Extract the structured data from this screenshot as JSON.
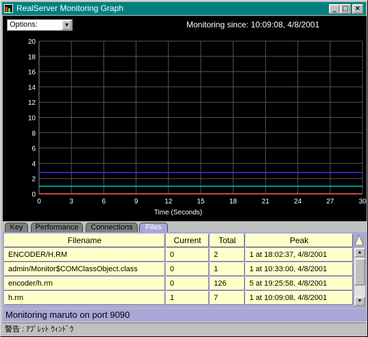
{
  "window": {
    "title": "RealServer Monitoring Graph",
    "controls": {
      "minimize": "_",
      "maximize": "□",
      "close": "×"
    },
    "icon": "app-icon"
  },
  "graph": {
    "options_label": "Options:",
    "monitoring_since": "Monitoring since: 10:09:08, 4/8/2001"
  },
  "chart_data": {
    "type": "line",
    "title": "",
    "xlabel": "Time (Seconds)",
    "ylabel": "",
    "x_ticks": [
      0,
      3,
      6,
      9,
      12,
      15,
      18,
      21,
      24,
      27,
      30
    ],
    "y_ticks": [
      0,
      2,
      4,
      6,
      8,
      10,
      12,
      14,
      16,
      18,
      20
    ],
    "xlim": [
      0,
      30
    ],
    "ylim": [
      0,
      20
    ],
    "grid": true,
    "series": [
      {
        "color": "#3030ff",
        "x": [
          0,
          30
        ],
        "y": [
          2.8,
          2.8
        ]
      },
      {
        "color": "#00c8c8",
        "x": [
          0,
          30
        ],
        "y": [
          1,
          1
        ]
      },
      {
        "color": "#ff6060",
        "x": [
          0,
          30
        ],
        "y": [
          0,
          0
        ]
      }
    ]
  },
  "tabs": [
    {
      "label": "Key",
      "active": false
    },
    {
      "label": "Performance",
      "active": false
    },
    {
      "label": "Connections",
      "active": false
    },
    {
      "label": "Files",
      "active": true
    }
  ],
  "files_table": {
    "headers": [
      "Filename",
      "Current",
      "Total",
      "Peak"
    ],
    "rows": [
      [
        "ENCODER/H.RM",
        "0",
        "2",
        "1 at 18:02:37, 4/8/2001"
      ],
      [
        "admin/Monitor$COMClassObject.class",
        "0",
        "1",
        "1 at 10:33:00, 4/8/2001"
      ],
      [
        "encoder/h.rm",
        "0",
        "126",
        "5 at 19:25:58, 4/8/2001"
      ],
      [
        "h.rm",
        "1",
        "7",
        "1 at 10:09:08, 4/8/2001"
      ]
    ]
  },
  "status_text": "Monitoring maruto on port 9090",
  "applet_warning": "警告 : ｱﾌﾟﾚｯﾄ ｳｨﾝﾄﾞｳ",
  "colors": {
    "title_bar": "#008080",
    "panel": "#a8a8d8",
    "cell": "#ffffc8",
    "grid": "#555555"
  }
}
